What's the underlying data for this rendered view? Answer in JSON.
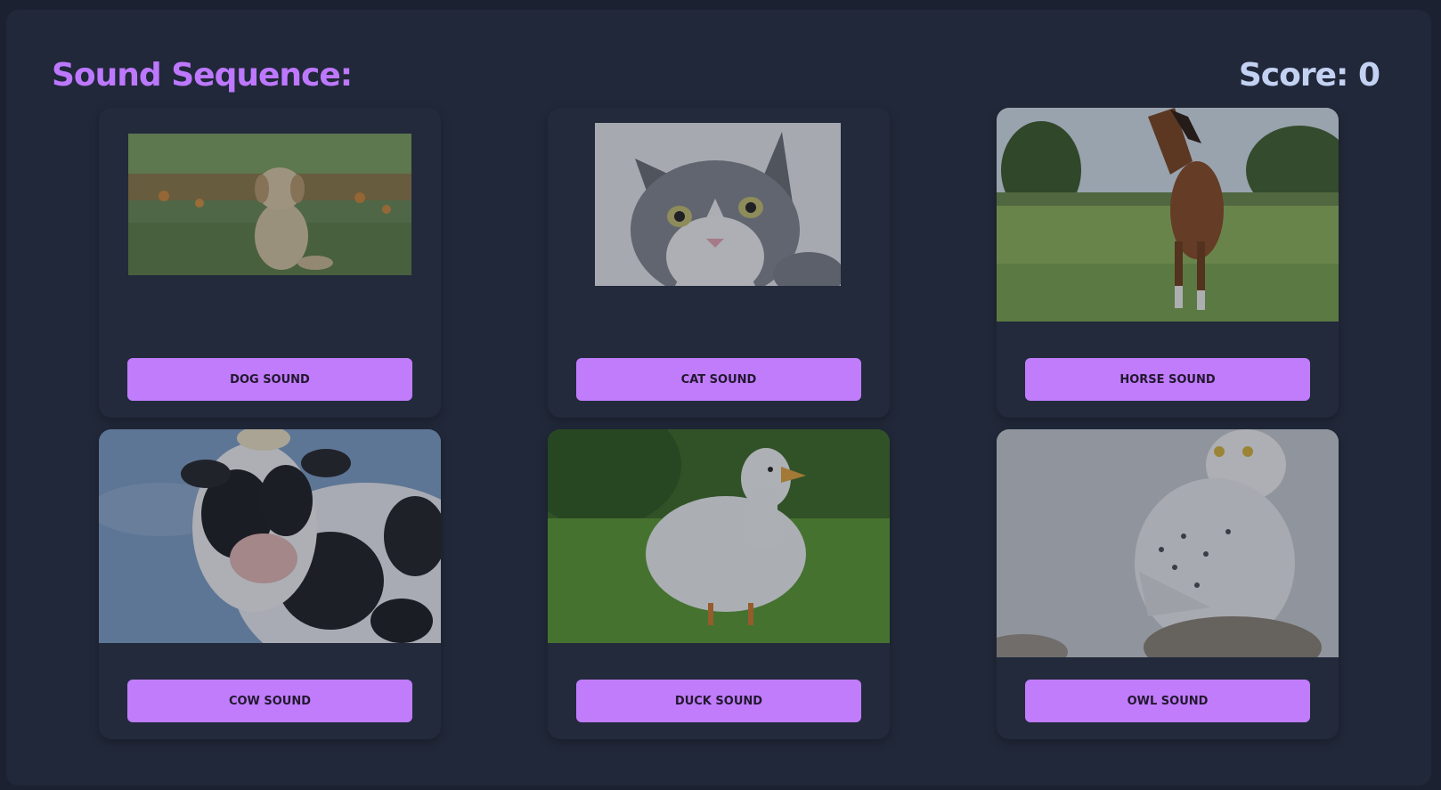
{
  "header": {
    "title": "Sound Sequence:",
    "score_text": "Score: 0"
  },
  "colors": {
    "background": "#212839",
    "title": "#bd78ff",
    "score": "#c3d1f2",
    "button": "#c07cfb",
    "button_text": "#22182f"
  },
  "cards": [
    {
      "animal": "dog",
      "image_icon": "dog-photo",
      "button_label": "DOG SOUND"
    },
    {
      "animal": "cat",
      "image_icon": "cat-photo",
      "button_label": "CAT SOUND"
    },
    {
      "animal": "horse",
      "image_icon": "horse-photo",
      "button_label": "HORSE SOUND"
    },
    {
      "animal": "cow",
      "image_icon": "cow-photo",
      "button_label": "COW SOUND"
    },
    {
      "animal": "duck",
      "image_icon": "duck-photo",
      "button_label": "DUCK SOUND"
    },
    {
      "animal": "owl",
      "image_icon": "owl-photo",
      "button_label": "OWL SOUND"
    }
  ]
}
